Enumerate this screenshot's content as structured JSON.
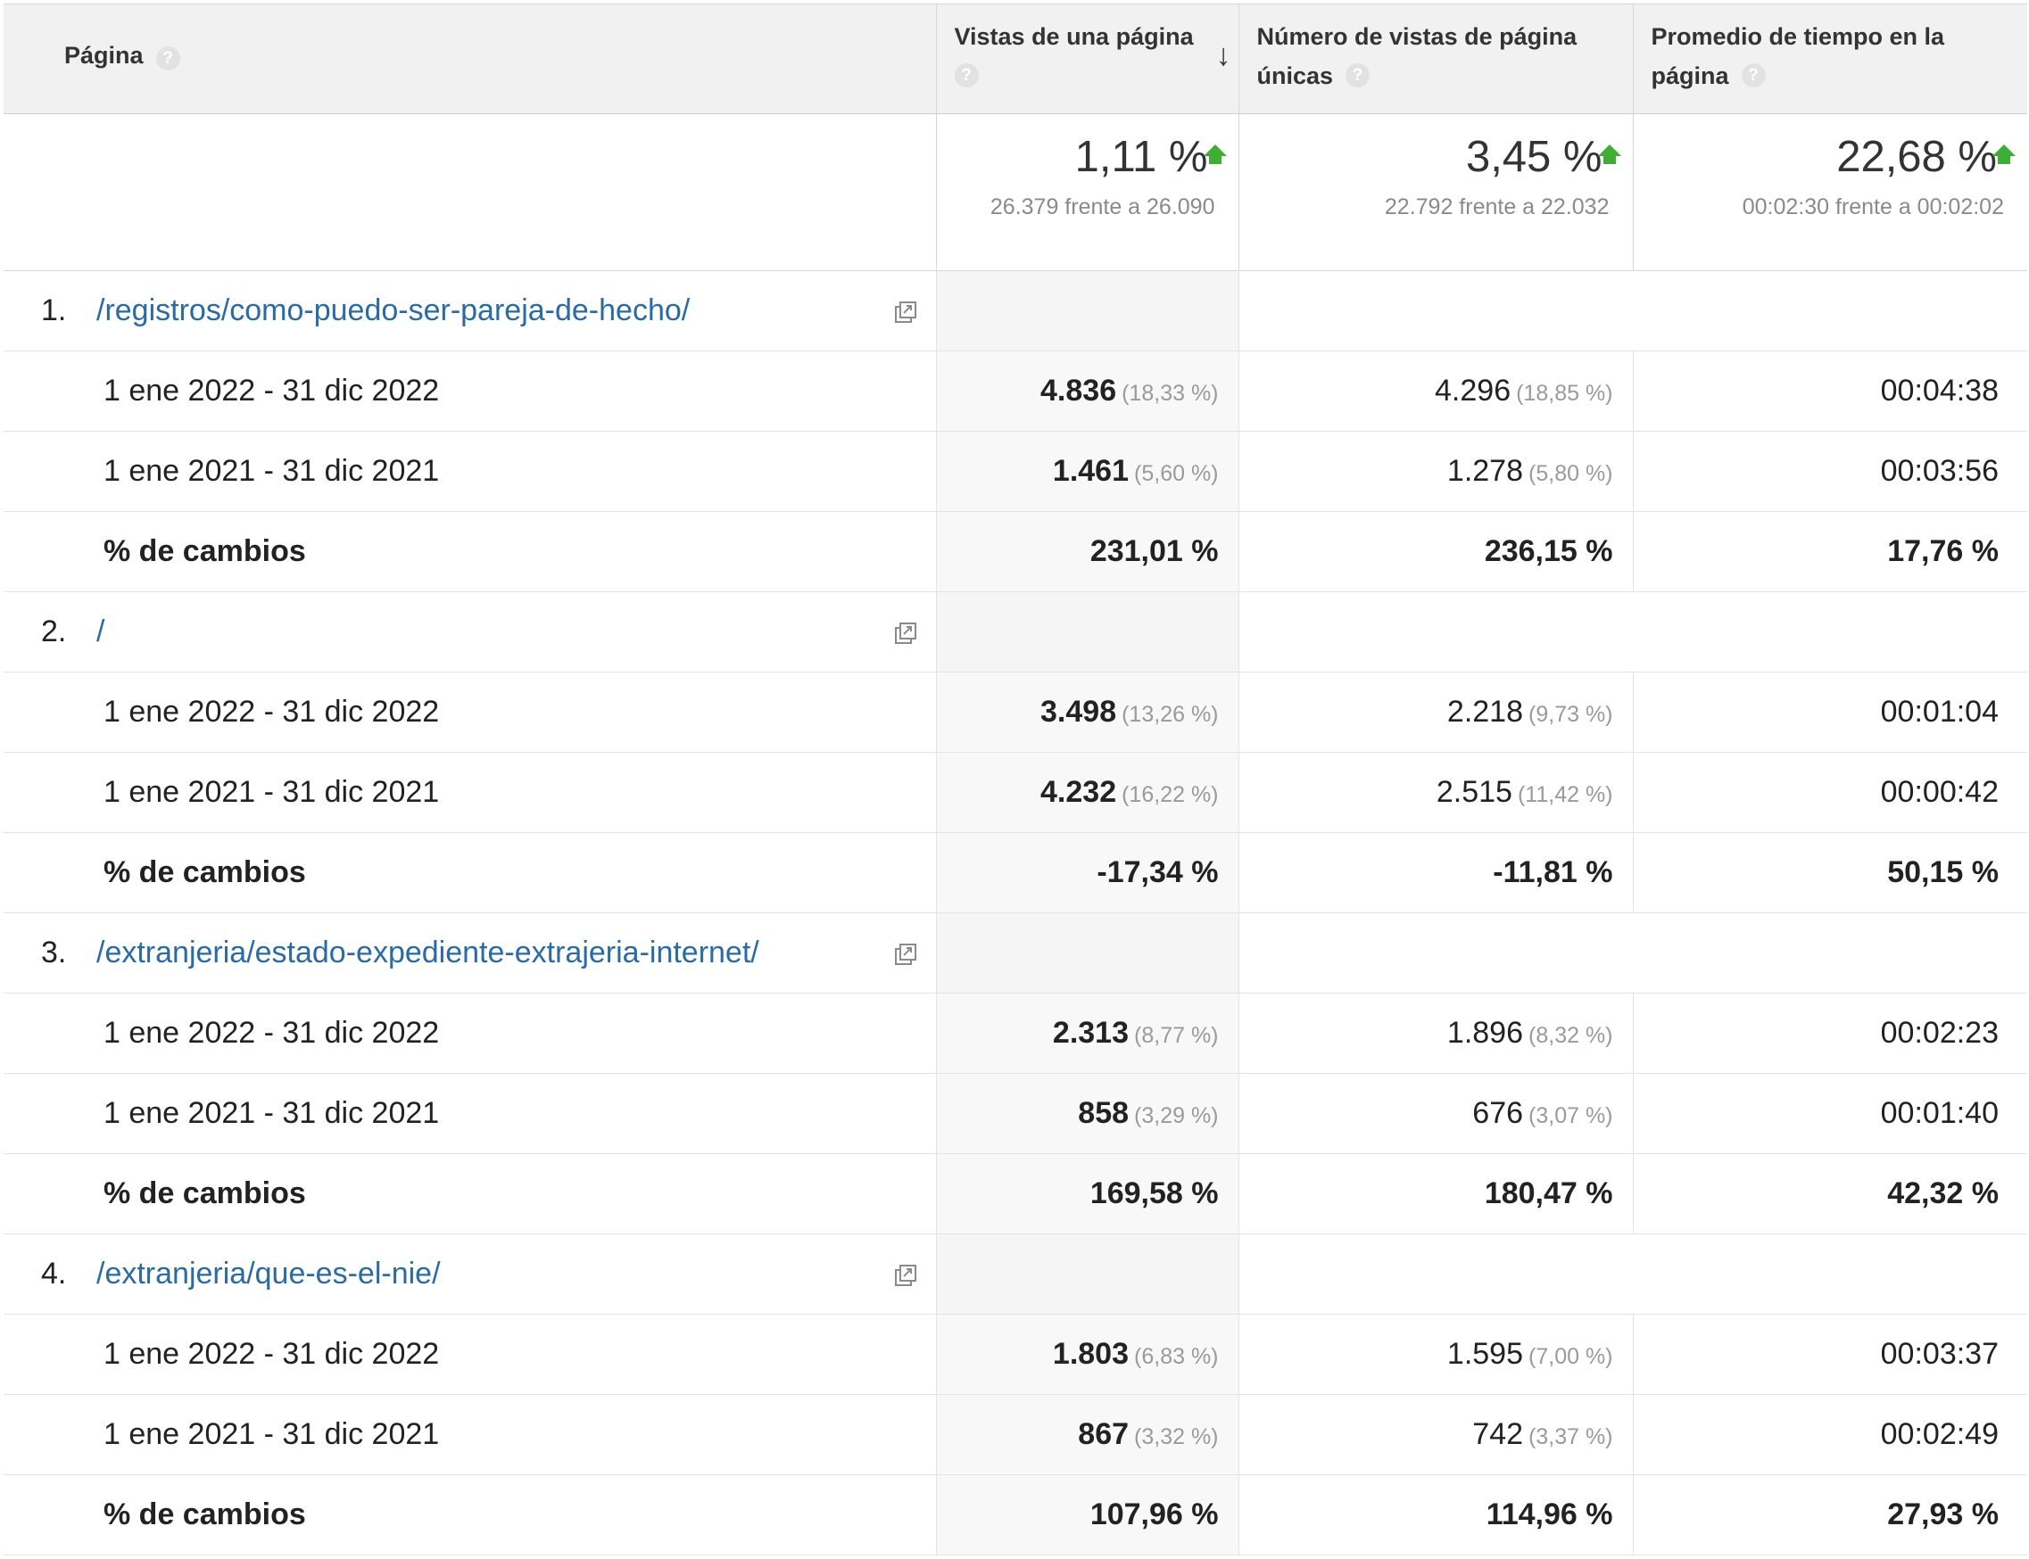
{
  "header": {
    "page": "Página",
    "views": "Vistas de una página",
    "unique": "Número de vistas de página únicas",
    "time": "Promedio de tiempo en la página",
    "help": "?"
  },
  "summary": {
    "views": {
      "value": "1,11 %",
      "compare": "26.379 frente a 26.090"
    },
    "unique": {
      "value": "3,45 %",
      "compare": "22.792 frente a 22.032"
    },
    "time": {
      "value": "22,68 %",
      "compare": "00:02:30 frente a 00:02:02"
    }
  },
  "groups": [
    {
      "index": "1.",
      "page": "/registros/como-puedo-ser-pareja-de-hecho/",
      "rows": [
        {
          "label": "1 ene 2022 - 31 dic 2022",
          "views": "4.836",
          "views_pct": "(18,33 %)",
          "unique": "4.296",
          "unique_pct": "(18,85 %)",
          "time": "00:04:38"
        },
        {
          "label": "1 ene 2021 - 31 dic 2021",
          "views": "1.461",
          "views_pct": "(5,60 %)",
          "unique": "1.278",
          "unique_pct": "(5,80 %)",
          "time": "00:03:56"
        }
      ],
      "change": {
        "label": "% de cambios",
        "views": "231,01 %",
        "unique": "236,15 %",
        "time": "17,76 %"
      }
    },
    {
      "index": "2.",
      "page": "/",
      "rows": [
        {
          "label": "1 ene 2022 - 31 dic 2022",
          "views": "3.498",
          "views_pct": "(13,26 %)",
          "unique": "2.218",
          "unique_pct": "(9,73 %)",
          "time": "00:01:04"
        },
        {
          "label": "1 ene 2021 - 31 dic 2021",
          "views": "4.232",
          "views_pct": "(16,22 %)",
          "unique": "2.515",
          "unique_pct": "(11,42 %)",
          "time": "00:00:42"
        }
      ],
      "change": {
        "label": "% de cambios",
        "views": "-17,34 %",
        "unique": "-11,81 %",
        "time": "50,15 %"
      }
    },
    {
      "index": "3.",
      "page": "/extranjeria/estado-expediente-extrajeria-internet/",
      "rows": [
        {
          "label": "1 ene 2022 - 31 dic 2022",
          "views": "2.313",
          "views_pct": "(8,77 %)",
          "unique": "1.896",
          "unique_pct": "(8,32 %)",
          "time": "00:02:23"
        },
        {
          "label": "1 ene 2021 - 31 dic 2021",
          "views": "858",
          "views_pct": "(3,29 %)",
          "unique": "676",
          "unique_pct": "(3,07 %)",
          "time": "00:01:40"
        }
      ],
      "change": {
        "label": "% de cambios",
        "views": "169,58 %",
        "unique": "180,47 %",
        "time": "42,32 %"
      }
    },
    {
      "index": "4.",
      "page": "/extranjeria/que-es-el-nie/",
      "rows": [
        {
          "label": "1 ene 2022 - 31 dic 2022",
          "views": "1.803",
          "views_pct": "(6,83 %)",
          "unique": "1.595",
          "unique_pct": "(7,00 %)",
          "time": "00:03:37"
        },
        {
          "label": "1 ene 2021 - 31 dic 2021",
          "views": "867",
          "views_pct": "(3,32 %)",
          "unique": "742",
          "unique_pct": "(3,37 %)",
          "time": "00:02:49"
        }
      ],
      "change": {
        "label": "% de cambios",
        "views": "107,96 %",
        "unique": "114,96 %",
        "time": "27,93 %"
      }
    }
  ],
  "icons": {
    "help": "help-circle-icon",
    "sort": "arrow-down-icon",
    "trend": "up-arrow-icon",
    "open": "open-in-new-window-icon"
  },
  "colors": {
    "link": "#2a6aa5",
    "positive": "#3fae35",
    "header_bg": "#f1f1f1"
  }
}
